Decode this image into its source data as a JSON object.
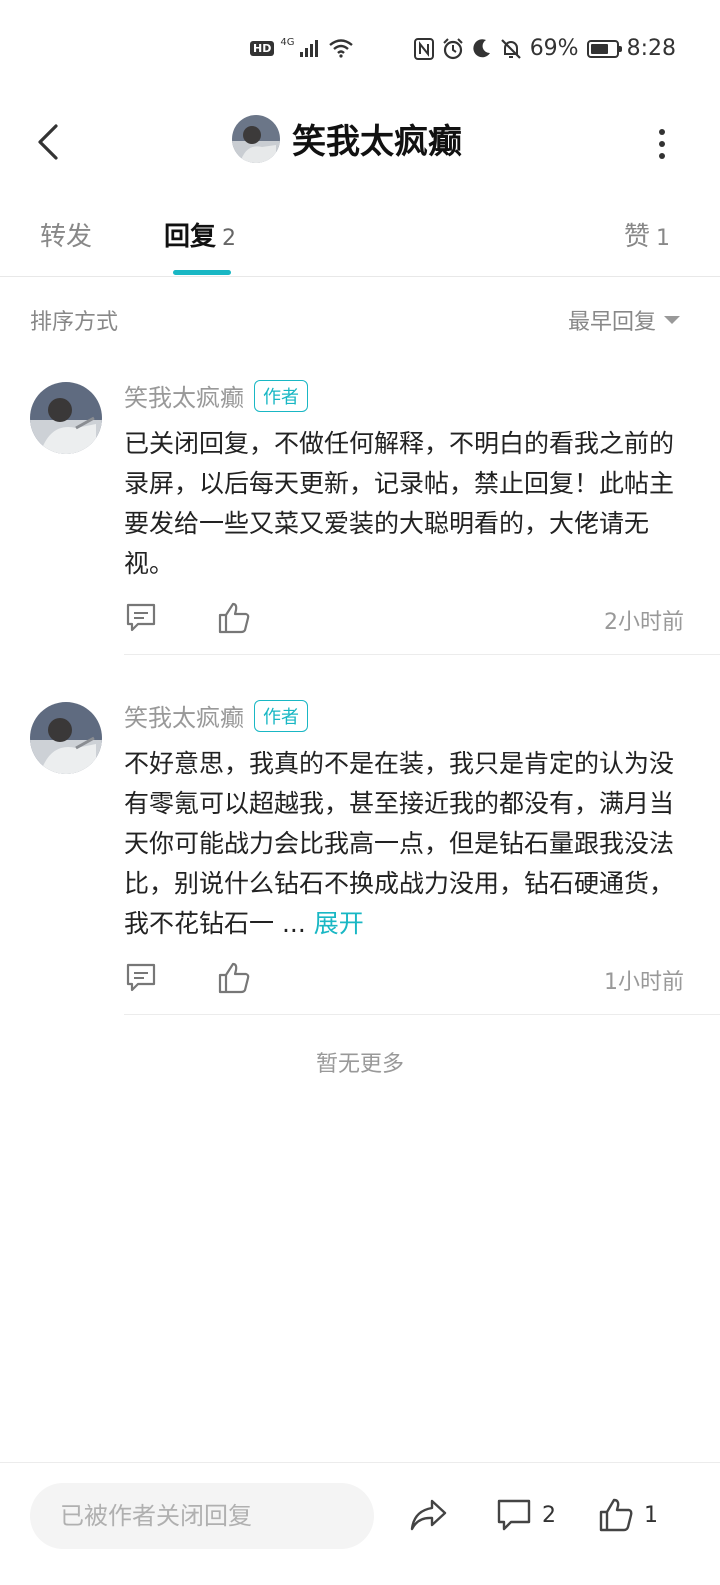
{
  "status_bar": {
    "hd": "HD",
    "network": "4G",
    "battery_percent_text": "69%",
    "battery_level": 0.69,
    "time": "8:28"
  },
  "header": {
    "title": "笑我太疯癫"
  },
  "tabs": {
    "forward_label": "转发",
    "reply_label": "回复",
    "reply_count": "2",
    "like_label": "赞",
    "like_count": "1"
  },
  "sort": {
    "label": "排序方式",
    "value": "最早回复"
  },
  "replies": [
    {
      "name": "笑我太疯癫",
      "badge": "作者",
      "text": "已关闭回复，不做任何解释，不明白的看我之前的录屏，以后每天更新，记录帖，禁止回复！此帖主要发给一些又菜又爱装的大聪明看的，大佬请无视。",
      "expand": "",
      "time": "2小时前"
    },
    {
      "name": "笑我太疯癫",
      "badge": "作者",
      "text": "不好意思，我真的不是在装，我只是肯定的认为没有零氪可以超越我，甚至接近我的都没有，满月当天你可能战力会比我高一点，但是钻石量跟我没法比，别说什么钻石不换成战力没用，钻石硬通货，我不花钻石一 ... ",
      "expand": "展开",
      "time": "1小时前"
    }
  ],
  "footer_note": "暂无更多",
  "bottom_bar": {
    "input_placeholder": "已被作者关闭回复",
    "comment_count": "2",
    "like_count": "1"
  },
  "colors": {
    "accent": "#19b7c4"
  }
}
